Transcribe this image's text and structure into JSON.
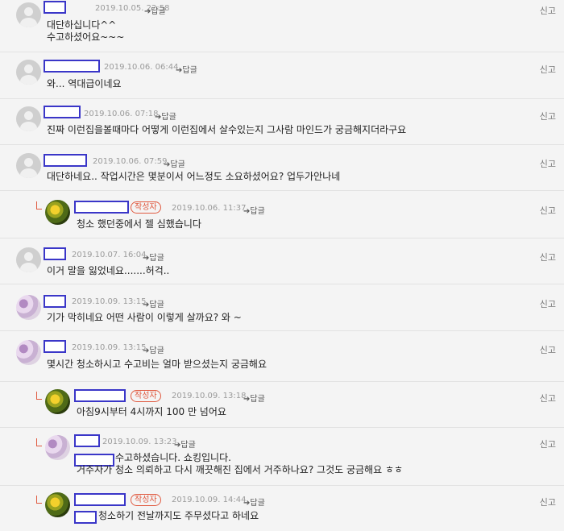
{
  "report_label": "신고",
  "reply_label": "➔답글",
  "author_badge": "작성자",
  "comments": [
    {
      "time": "2019.10.05. 22:58",
      "lines": [
        "대단하십니다^^",
        "수고하셨어요~~~"
      ]
    },
    {
      "time": "2019.10.06. 06:44",
      "lines": [
        "와... 역대급이네요"
      ]
    },
    {
      "time": "2019.10.06. 07:18",
      "lines": [
        "진짜 이런집을볼때마다 어떻게 이런집에서 살수있는지 그사람 마인드가 궁금해지더라구요"
      ]
    },
    {
      "time": "2019.10.06. 07:59",
      "lines": [
        "대단하네요.. 작업시간은 몇분이서 어느정도 소요하셨어요? 업두가안나네"
      ]
    },
    {
      "time": "2019.10.06. 11:37",
      "lines": [
        "청소 했던중에서 젤 심했습니다"
      ]
    },
    {
      "time": "2019.10.07. 16:04",
      "lines": [
        "이거 말을 잃었네요.......허걱.."
      ]
    },
    {
      "time": "2019.10.09. 13:15",
      "lines": [
        "기가 막히네요 어떤 사람이 이렇게 살까요? 와 ~"
      ]
    },
    {
      "time": "2019.10.09. 13:15",
      "lines": [
        "몇시간 청소하시고 수고비는 얼마 받으셨는지 궁금해요"
      ]
    },
    {
      "time": "2019.10.09. 13:18",
      "lines": [
        "아침9시부터 4시까지 100 만 넘어요"
      ]
    },
    {
      "time": "2019.10.09. 13:23",
      "lines": [
        "수고하셨습니다. 쇼킹입니다.",
        "거주자가 청소 의뢰하고 다시 깨끗해진 집에서 거주하나요? 그것도 궁금해요 ㅎㅎ"
      ]
    },
    {
      "time": "2019.10.09. 14:44",
      "lines": [
        "청소하기 전날까지도 주무셨다고 하네요"
      ]
    }
  ]
}
